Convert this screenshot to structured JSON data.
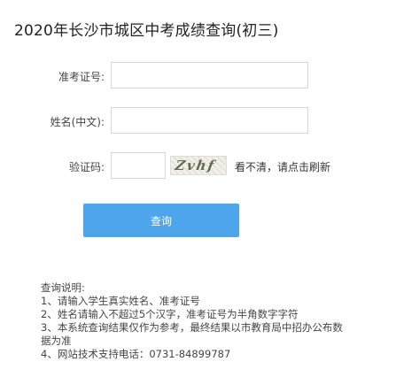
{
  "page": {
    "title": "2020年长沙市城区中考成绩查询(初三)"
  },
  "form": {
    "exam_number_label": "准考证号:",
    "exam_number_value": "",
    "name_label": "姓名(中文):",
    "name_value": "",
    "captcha_label": "验证码:",
    "captcha_value": "",
    "captcha_image_text": "Zvhf",
    "refresh_label": "看不清，请点击刷新",
    "submit_label": "查询"
  },
  "notes": {
    "heading": "查询说明:",
    "items": [
      "1、请输入学生真实姓名、准考证号",
      "2、姓名请输入不超过5个汉字，准考证号为半角数字字符",
      "3、本系统查询结果仅作为参考，最终结果以市教育局中招办公布数据为准",
      "4、网站技术支持电话：0731-84899787"
    ]
  }
}
